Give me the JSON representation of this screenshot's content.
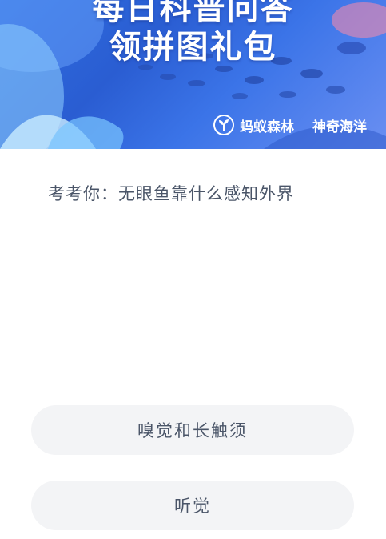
{
  "banner": {
    "title_line_1": "每日科普问答",
    "title_line_2": "领拼图礼包",
    "brand_name": "蚂蚁森林",
    "partner_name": "神奇海洋",
    "logo_icon": "sprout-circle-icon",
    "colors": {
      "primary": "#2f6fe0",
      "accent": "#ffffff"
    }
  },
  "quiz": {
    "question": "考考你：无眼鱼靠什么感知外界",
    "options": [
      {
        "label": "嗅觉和长触须"
      },
      {
        "label": "听觉"
      }
    ]
  }
}
